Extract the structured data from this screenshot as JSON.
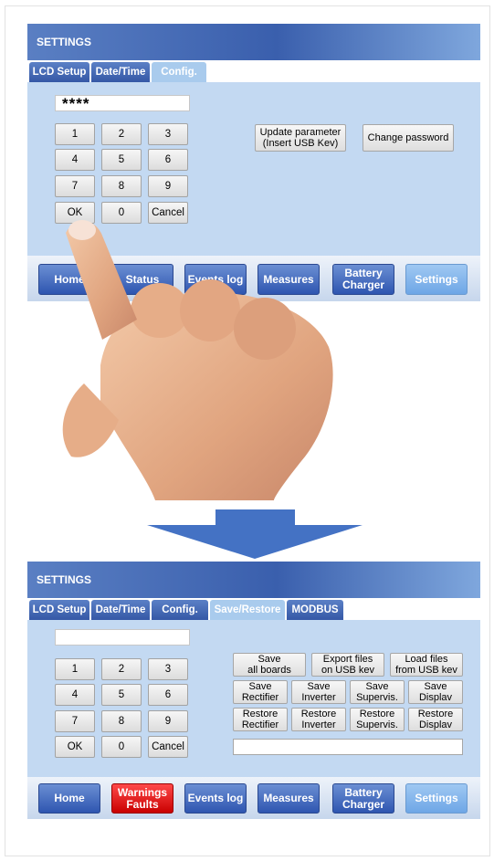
{
  "screen1": {
    "title": "SETTINGS",
    "tabs": [
      {
        "label": "LCD Setup",
        "active": false
      },
      {
        "label": "Date/Time",
        "active": false
      },
      {
        "label": "Config.",
        "active": true
      }
    ],
    "pin_value": "****",
    "keypad": [
      "1",
      "2",
      "3",
      "4",
      "5",
      "6",
      "7",
      "8",
      "9",
      "OK",
      "0",
      "Cancel"
    ],
    "update_button": "Update parameter\n(Insert USB Kev)",
    "change_password_button": "Change password",
    "nav": [
      "Home",
      "Status",
      "Events log",
      "Measures",
      "Battery\nCharger",
      "Settings"
    ]
  },
  "screen2": {
    "title": "SETTINGS",
    "tabs": [
      {
        "label": "LCD Setup",
        "active": false
      },
      {
        "label": "Date/Time",
        "active": false
      },
      {
        "label": "Config.",
        "active": false
      },
      {
        "label": "Save/Restore",
        "active": true
      },
      {
        "label": "MODBUS",
        "active": false
      }
    ],
    "pin_value": "",
    "keypad": [
      "1",
      "2",
      "3",
      "4",
      "5",
      "6",
      "7",
      "8",
      "9",
      "OK",
      "0",
      "Cancel"
    ],
    "actions_row1": [
      "Save\nall boards",
      "Export files\non USB kev",
      "Load files\nfrom USB kev"
    ],
    "actions_row2": [
      "Save\nRectifier",
      "Save\nInverter",
      "Save\nSupervis.",
      "Save\nDisplav"
    ],
    "actions_row3": [
      "Restore\nRectifier",
      "Restore\nInverter",
      "Restore\nSupervis.",
      "Restore\nDisplav"
    ],
    "nav": [
      "Home",
      "Warnings\nFaults",
      "Events log",
      "Measures",
      "Battery\nCharger",
      "Settings"
    ]
  },
  "colors": {
    "accent": "#3a5fad",
    "panel": "#c3d9f2",
    "warning": "#e00000",
    "arrow": "#4472c4"
  }
}
